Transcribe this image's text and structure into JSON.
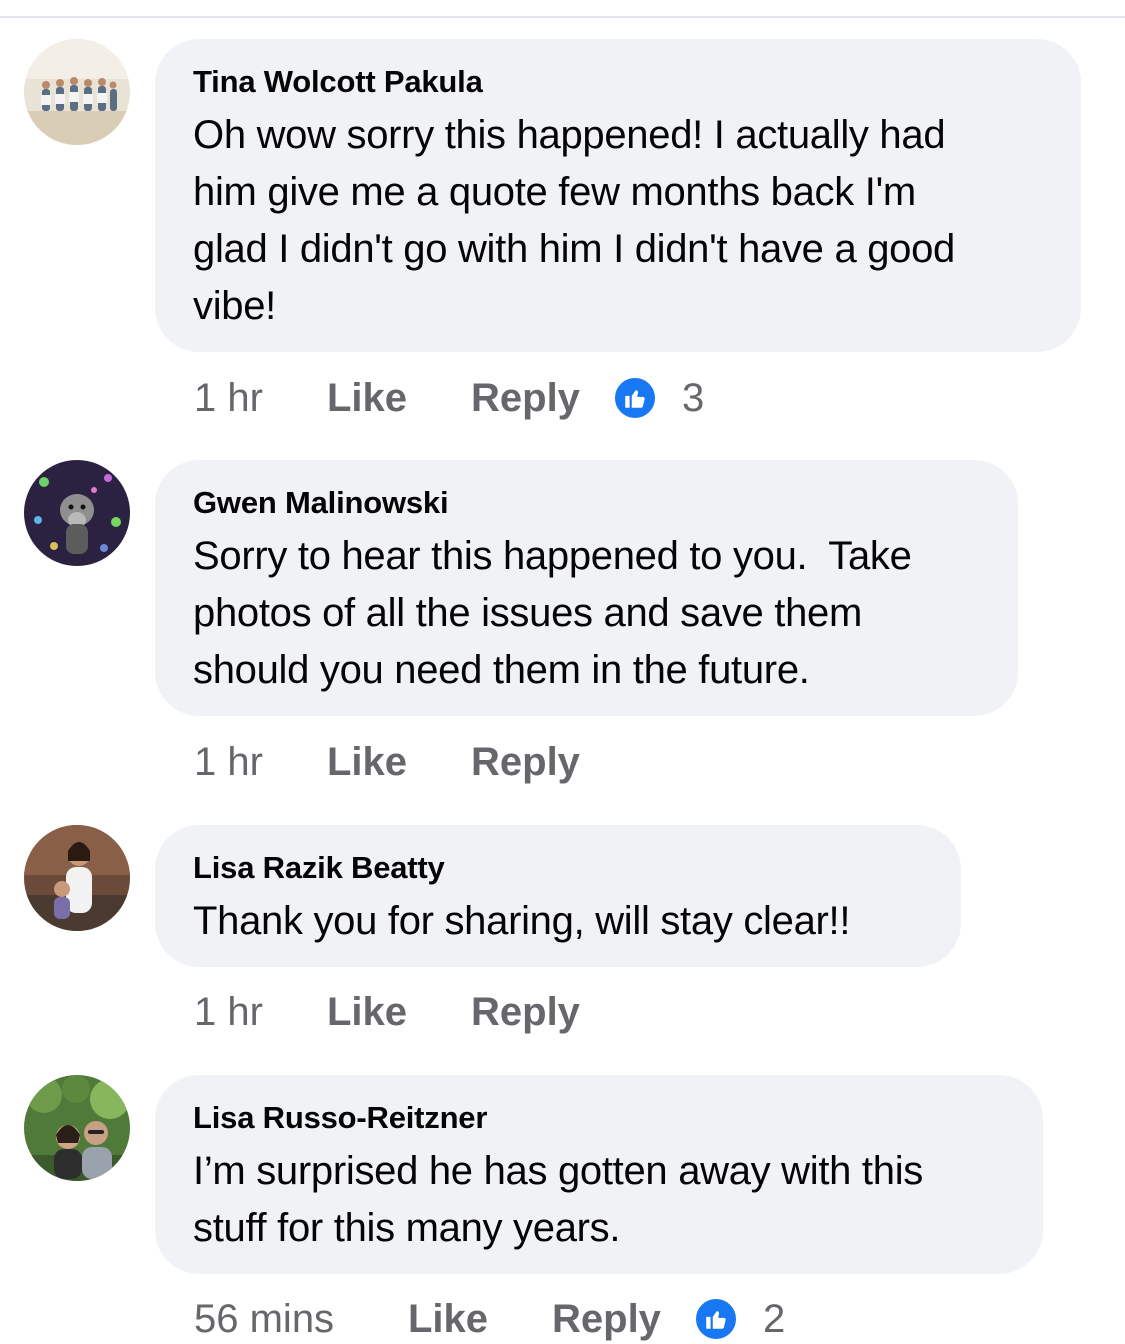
{
  "comments": [
    {
      "author": "Tina Wolcott Pakula",
      "text_lines": [
        "Oh wow sorry this happened! I actually had",
        "him give me a quote few months back I'm",
        "glad I didn't go with him I didn't have a good",
        "vibe!"
      ],
      "time": "1 hr",
      "like_label": "Like",
      "reply_label": "Reply",
      "reaction_icon": "thumbs-up-icon",
      "reaction_count": "3"
    },
    {
      "author": "Gwen Malinowski",
      "text_lines": [
        "Sorry to hear this happened to you.  Take",
        "photos of all the issues and save them",
        "should you need them in the future."
      ],
      "time": "1 hr",
      "like_label": "Like",
      "reply_label": "Reply"
    },
    {
      "author": "Lisa Razik Beatty",
      "text_lines": [
        "Thank you for sharing, will stay clear!!"
      ],
      "time": "1 hr",
      "like_label": "Like",
      "reply_label": "Reply"
    },
    {
      "author": "Lisa Russo-Reitzner",
      "text_lines": [
        "I’m surprised he has gotten away with this",
        "stuff for this many years."
      ],
      "time": "56 mins",
      "like_label": "Like",
      "reply_label": "Reply",
      "reaction_icon": "thumbs-up-icon",
      "reaction_count": "2"
    }
  ],
  "colors": {
    "bubble_bg": "#f0f2f5",
    "text": "#050505",
    "meta_text": "#65676b",
    "like_blue": "#1877f2"
  }
}
